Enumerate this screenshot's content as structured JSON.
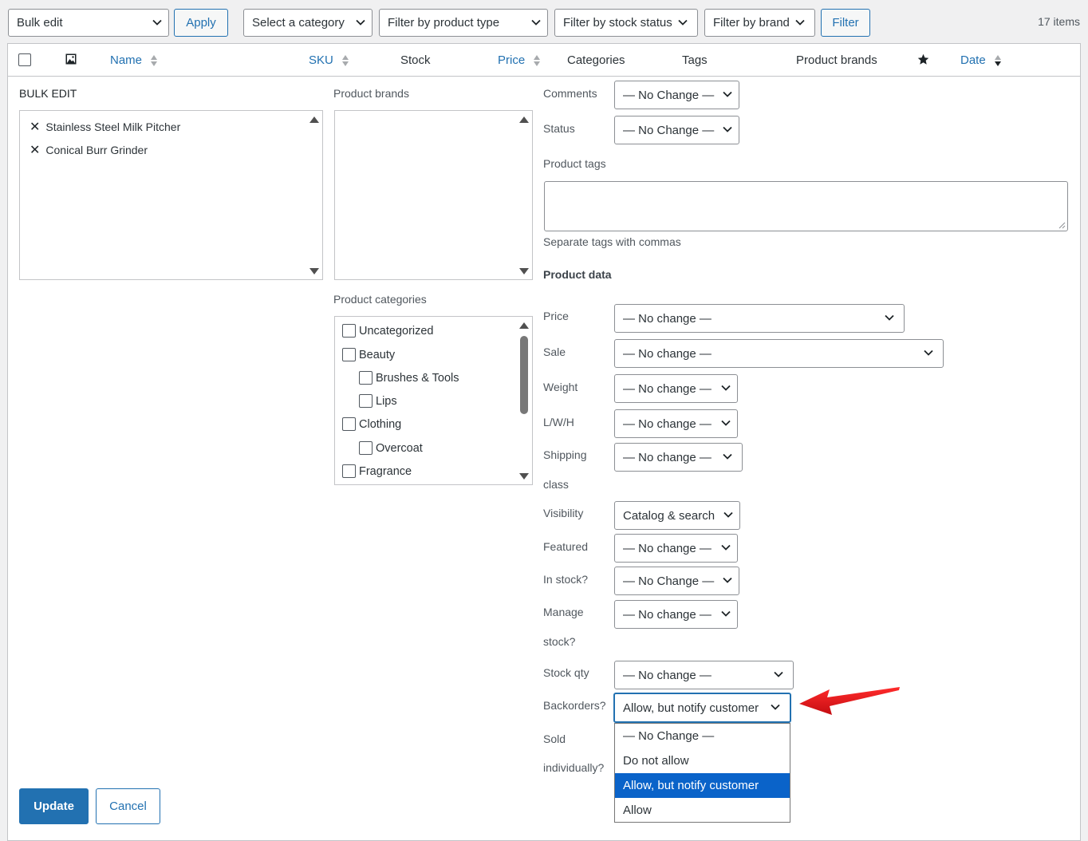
{
  "toolbar": {
    "bulk_action": "Bulk edit",
    "apply_label": "Apply",
    "category_filter": "Select a category",
    "product_type_filter": "Filter by product type",
    "stock_status_filter": "Filter by stock status",
    "brand_filter": "Filter by brand",
    "filter_label": "Filter",
    "items_count": "17 items"
  },
  "table_header": {
    "name": "Name",
    "sku": "SKU",
    "stock": "Stock",
    "price": "Price",
    "categories": "Categories",
    "tags": "Tags",
    "product_brands": "Product brands",
    "date": "Date"
  },
  "bulk_edit": {
    "heading": "BULK EDIT",
    "titles": [
      "Stainless Steel Milk Pitcher",
      "Conical Burr Grinder"
    ],
    "brands_label": "Product brands",
    "categories_label": "Product categories",
    "categories": [
      "Uncategorized",
      "Beauty",
      "Brushes & Tools",
      "Lips",
      "Clothing",
      "Overcoat",
      "Fragrance"
    ],
    "comments_label": "Comments",
    "comments_value": "— No Change —",
    "status_label": "Status",
    "status_value": "— No Change —",
    "tags_label": "Product tags",
    "tags_hint": "Separate tags with commas",
    "product_data_label": "Product data",
    "price_label": "Price",
    "price_value": "— No change —",
    "sale_label": "Sale",
    "sale_value": "— No change —",
    "weight_label": "Weight",
    "weight_value": "— No change —",
    "lwh_label": "L/W/H",
    "lwh_value": "— No change —",
    "shipping_label_1": "Shipping",
    "shipping_label_2": "class",
    "shipping_value": "— No change —",
    "visibility_label": "Visibility",
    "visibility_value": "Catalog & search",
    "featured_label": "Featured",
    "featured_value": "— No change —",
    "instock_label": "In stock?",
    "instock_value": "— No Change —",
    "manage_label_1": "Manage",
    "manage_label_2": "stock?",
    "manage_value": "— No change —",
    "stockqty_label": "Stock qty",
    "stockqty_value": "— No change —",
    "backorders_label": "Backorders?",
    "backorders_value": "Allow, but notify customer",
    "backorders_options": [
      "— No Change —",
      "Do not allow",
      "Allow, but notify customer",
      "Allow"
    ],
    "sold_label_1": "Sold",
    "sold_label_2": "individually?",
    "update_label": "Update",
    "cancel_label": "Cancel"
  },
  "colors": {
    "accent": "#2271b1",
    "selected_option": "#0a63c9",
    "arrow": "#e0161c"
  }
}
